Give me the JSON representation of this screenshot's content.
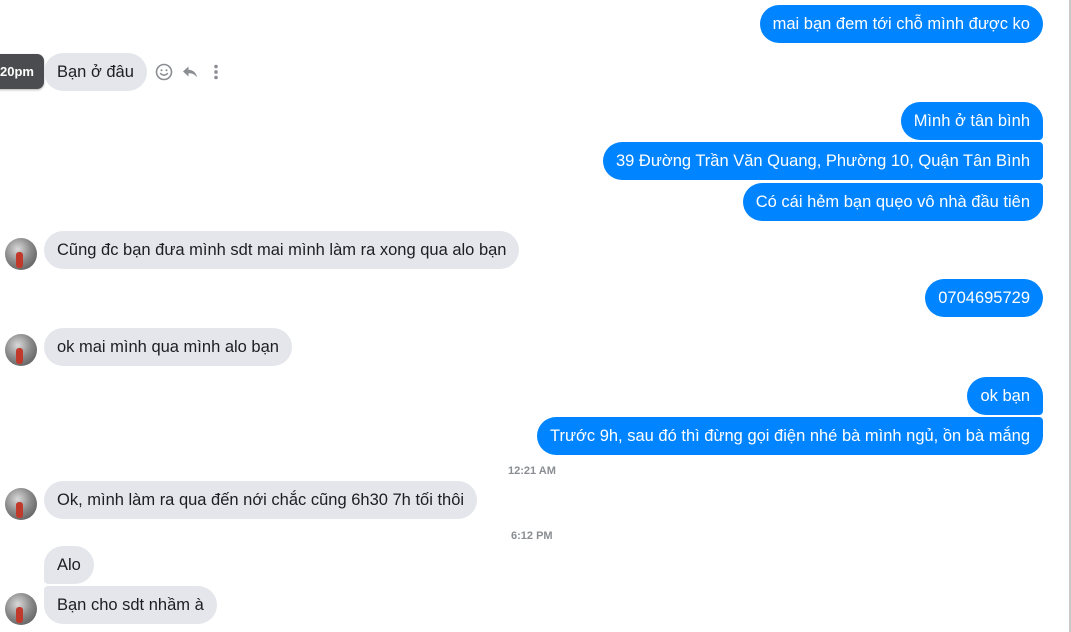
{
  "colors": {
    "sent_bubble": "#0084ff",
    "received_bubble": "#e4e6eb",
    "timestamp_text": "#8a8d91"
  },
  "hover_tooltip": {
    "time": "20pm"
  },
  "message_actions": {
    "icons": [
      "emoji-react-icon",
      "reply-icon",
      "more-options-icon"
    ]
  },
  "messages": [
    {
      "side": "sent",
      "text": "mai bạn đem tới chỗ mình được ko"
    },
    {
      "side": "received",
      "text": "Bạn ở đâu"
    },
    {
      "side": "sent",
      "text": "Mình ở tân bình"
    },
    {
      "side": "sent",
      "text": "39 Đường Trần Văn Quang, Phường 10, Quận Tân Bình"
    },
    {
      "side": "sent",
      "text": "Có cái hẻm bạn quẹo vô nhà đầu tiên"
    },
    {
      "side": "received",
      "text": "Cũng đc bạn đưa mình sdt mai mình làm ra xong qua alo bạn"
    },
    {
      "side": "sent",
      "text": "0704695729"
    },
    {
      "side": "received",
      "text": "ok mai mình qua mình alo bạn"
    },
    {
      "side": "sent",
      "text": "ok bạn"
    },
    {
      "side": "sent",
      "text": "Trước 9h, sau đó thì đừng gọi điện nhé bà mình ngủ, ồn bà mắng"
    },
    {
      "side": "received",
      "text": "Ok, mình làm ra qua đến nới chắc cũng 6h30 7h tối thôi"
    },
    {
      "side": "received",
      "text": "Alo"
    },
    {
      "side": "received",
      "text": "Bạn cho sdt nhầm à"
    }
  ],
  "timestamps": [
    "12:21 AM",
    "6:12 PM"
  ]
}
